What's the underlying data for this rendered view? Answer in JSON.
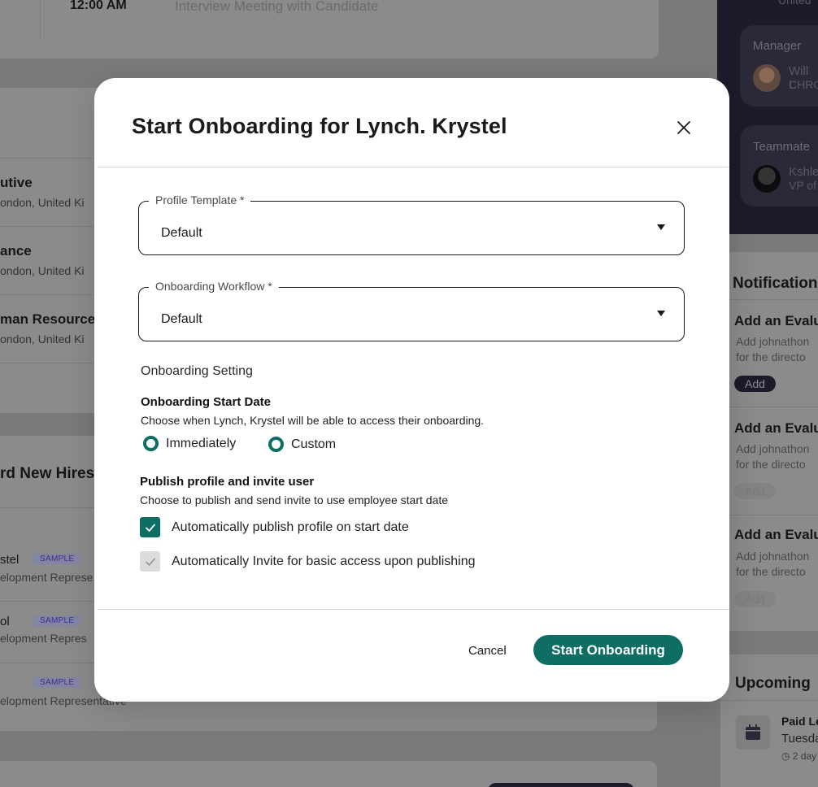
{
  "background": {
    "meeting": {
      "time": "12:00 AM",
      "description": "Interview Meeting with Candidate"
    },
    "jobs": [
      {
        "title": "utive",
        "location": "ondon, United Ki"
      },
      {
        "title": "ance",
        "location": "ondon, United Ki"
      },
      {
        "title": "man Resource",
        "location": "ondon, United Ki"
      }
    ],
    "hires_section": {
      "title": "rd New Hires",
      "items": [
        {
          "name": "stel",
          "badge": "SAMPLE",
          "role": "elopment Represe"
        },
        {
          "name": "ol",
          "badge": "SAMPLE",
          "role": "elopment Repres"
        },
        {
          "name": "",
          "badge": "SAMPLE",
          "role": "elopment Representative"
        }
      ]
    },
    "right_panel": {
      "top_text": "United",
      "manager": {
        "label": "Manager",
        "name": "Will L",
        "title": "CHRO"
      },
      "teammate": {
        "label": "Teammate",
        "name": "Kshle",
        "title": "VP of"
      }
    },
    "notifications": {
      "title": "Notification",
      "items": [
        {
          "title": "Add an Evalu",
          "line1": "Add johnathon",
          "line2": "for the directo",
          "button": "Add"
        },
        {
          "title": "Add an Evalu",
          "line1": "Add johnathon",
          "line2": "for the directo",
          "button": "Add"
        },
        {
          "title": "Add an Evalu",
          "line1": "Add johnathon",
          "line2": "for the directo",
          "button": "Add"
        }
      ]
    },
    "upcoming": {
      "title": "Upcoming",
      "event": {
        "title": "Paid Le",
        "day": "Tuesda",
        "meta": "2 day"
      }
    }
  },
  "modal": {
    "title": "Start Onboarding for Lynch. Krystel",
    "profile_template": {
      "label": "Profile Template *",
      "value": "Default"
    },
    "onboarding_workflow": {
      "label": "Onboarding Workflow *",
      "value": "Default"
    },
    "settings_label": "Onboarding Setting",
    "start_date": {
      "heading": "Onboarding Start Date",
      "description": "Choose when Lynch, Krystel will be able to access their onboarding.",
      "options": [
        "Immediately",
        "Custom"
      ]
    },
    "publish": {
      "heading": "Publish profile and invite user",
      "description": "Choose to publish and send invite to use employee start date",
      "options": [
        {
          "label": "Automatically publish profile on start date",
          "checked": true,
          "disabled": false
        },
        {
          "label": "Automatically Invite for basic access upon publishing",
          "checked": true,
          "disabled": true
        }
      ]
    },
    "cancel_label": "Cancel",
    "submit_label": "Start Onboarding"
  },
  "colors": {
    "accent": "#0e6e64",
    "overlay": "#7a7a7b",
    "dark_panel": "#1d1a2a"
  }
}
